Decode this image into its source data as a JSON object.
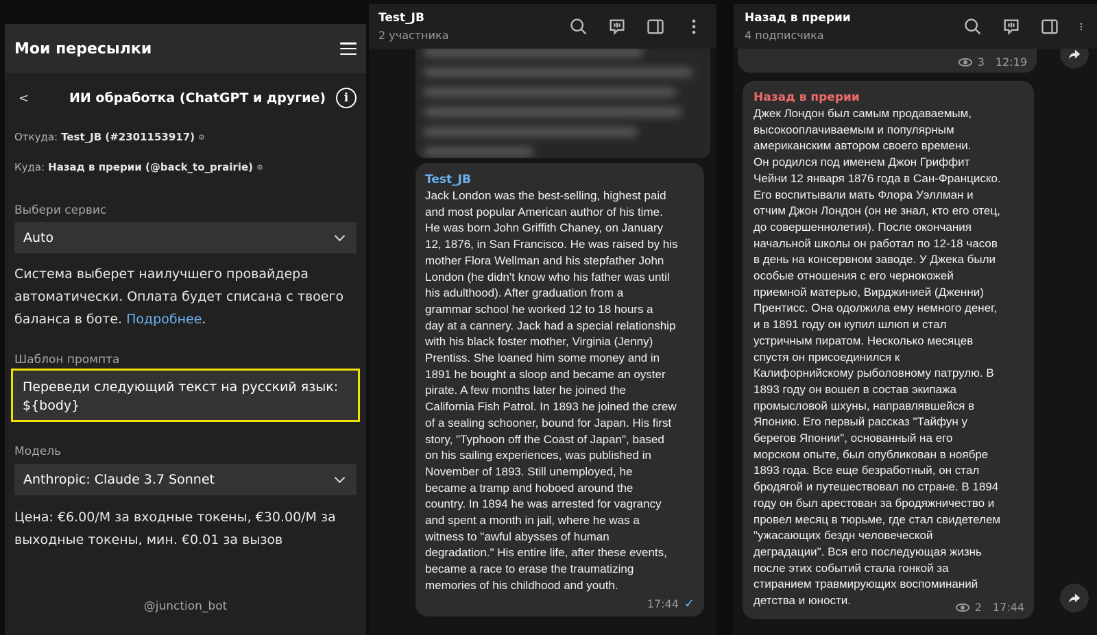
{
  "left": {
    "header_title": "Мои пересылки",
    "back_label": "<",
    "sub_title": "ИИ обработка (ChatGPT и другие)",
    "info_label": "i",
    "from_label": "Откуда:",
    "from_value": "Test_JB (#2301153917)",
    "to_label": "Куда:",
    "to_value": "Назад в прерии (@back_to_prairie)",
    "gear": "⚙",
    "service_label": "Выбери сервис",
    "service_value": "Auto",
    "service_desc": "Система выберет наилучшего провайдера автоматически. Оплата будет списана с твоего баланса в боте.",
    "service_link": "Подробнее",
    "service_desc_end": ".",
    "prompt_label": "Шаблон промпта",
    "prompt_value": "Переведи следующий текст на русский язык: ${body}",
    "model_label": "Модель",
    "model_value": "Anthropic: Claude 3.7 Sonnet",
    "price_text": "Цена: €6.00/M за входные токены, €30.00/M за выходные токены, мин. €0.01 за вызов",
    "bot_name": "@junction_bot"
  },
  "mid": {
    "chat_name": "Test_JB",
    "chat_sub": "2 участника",
    "sender": "Test_JB",
    "message": "Jack London was the best-selling, highest paid\nand most popular American author of his time.\nHe was born John Griffith Chaney, on January\n12, 1876, in San Francisco. He was raised by his\nmother Flora Wellman and his stepfather John\nLondon (he didn't know who his father was until\nhis adulthood). After graduation from a\ngrammar school he worked 12 to 18 hours a\nday at a cannery. Jack had a special relationship\nwith his black foster mother, Virginia (Jenny)\nPrentiss. She loaned him some money and in\n1891 he bought a sloop and became an oyster\npirate. A few months later he joined the\nCalifornia Fish Patrol. In 1893 he joined the crew\nof a sealing schooner, bound for Japan. His first\nstory, \"Typhoon off the Coast of Japan\", based\non his sailing experiences, was published in\nNovember of 1893. Still unemployed, he\nbecame a tramp and hoboed around the\ncountry. In 1894 he was arrested for vagrancy\nand spent a month in jail, where he was a\nwitness to \"awful abysses of human\ndegradation.\" His entire life, after these events,\nbecame a race to erase the traumatizing\nmemories of his childhood and youth.",
    "time": "17:44",
    "check": "✓"
  },
  "right": {
    "chat_name": "Назад в прерии",
    "chat_sub": "4 подписчика",
    "prev_views": "3",
    "prev_time": "12:19",
    "sender": "Назад в прерии",
    "message": "Джек Лондон был самым продаваемым,\nвысокооплачиваемым и популярным\nамериканским автором своего времени.\nОн родился под именем Джон Гриффит\nЧейни 12 января 1876 года в Сан-Франциско.\nЕго воспитывали мать Флора Уэллман и\nотчим Джон Лондон (он не знал, кто его отец,\nдо совершеннолетия). После окончания\nначальной школы он работал по 12-18 часов\nв день на консервном заводе. У Джека были\nособые отношения с его чернокожей\nприемной матерью, Вирджинией (Дженни)\nПрентисс. Она одолжила ему немного денег,\nи в 1891 году он купил шлюп и стал\nустричным пиратом. Несколько месяцев\nспустя он присоединился к\nКалифорнийскому рыболовному патрулю. В\n1893 году он вошел в состав экипажа\nпромысловой шхуны, направлявшейся в\nЯпонию. Его первый рассказ \"Тайфун у\nберегов Японии\", основанный на его\nморском опыте, был опубликован в ноябре\n1893 года. Все еще безработный, он стал\nбродягой и путешествовал по стране. В 1894\nгоду он был арестован за бродяжничество и\nпровел месяц в тюрьме, где стал свидетелем\n\"ужасающих бездн человеческой\nдеградации\". Вся его последующая жизнь\nпосле этих событий стала гонкой за\nстиранием травмирующих воспоминаний\nдетства и юности.",
    "views": "2",
    "time": "17:44"
  },
  "icons": [
    "hamburger-menu-icon",
    "back-arrow-icon",
    "info-icon",
    "gear-icon",
    "chevron-down-icon",
    "search-icon",
    "voice-chat-icon",
    "sidebar-toggle-icon",
    "more-vertical-icon",
    "eye-icon",
    "forward-icon",
    "read-check-icon"
  ],
  "colors": {
    "accent_blue": "#6ab3f3",
    "highlight_yellow": "#f2e000",
    "sender_red": "#ee6b6b",
    "bubble_bg": "#2d2d2d",
    "panel_bg": "#212121"
  }
}
